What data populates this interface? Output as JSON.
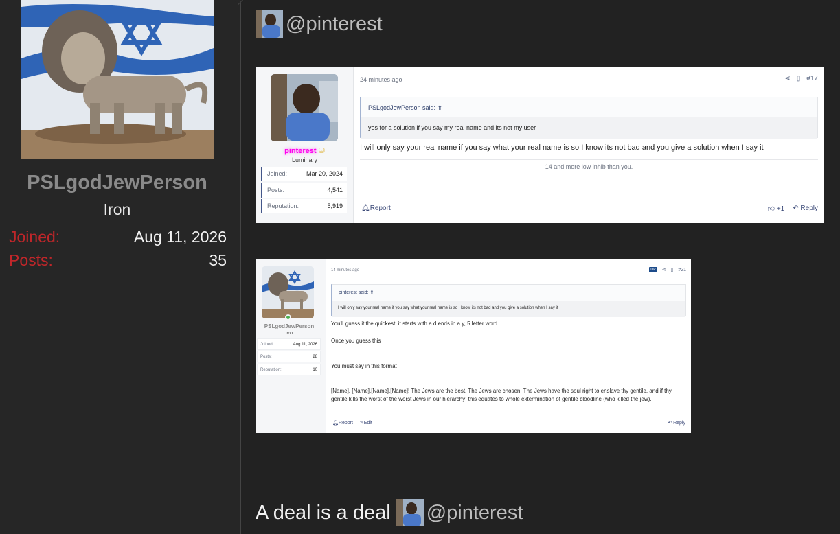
{
  "author": {
    "username": "PSLgodJewPerson",
    "rank": "Iron",
    "stats": [
      {
        "label": "Joined:",
        "value": "Aug 11, 2026"
      },
      {
        "label": "Posts:",
        "value": "35"
      }
    ]
  },
  "post": {
    "mention_top": "@pinterest",
    "closing_text": "A deal is a deal",
    "mention_bottom": "@pinterest"
  },
  "screenshot1": {
    "user": {
      "name": "pinterest",
      "rank": "Luminary",
      "stats": [
        {
          "label": "Joined:",
          "value": "Mar 20, 2024"
        },
        {
          "label": "Posts:",
          "value": "4,541"
        },
        {
          "label": "Reputation:",
          "value": "5,919"
        }
      ]
    },
    "time": "24 minutes ago",
    "post_number": "#17",
    "quote_author": "PSLgodJewPerson said:",
    "quote_text": "yes for a solution if you say my real name and its not my user",
    "body": "I will only say your real name if you say what your real name is so I know its not bad and you give a solution when I say it",
    "signature": "14 and more low inhib than you.",
    "report_label": "Report",
    "like_count": "+1",
    "reply_label": "Reply"
  },
  "screenshot2": {
    "user": {
      "name": "PSLgodJewPerson",
      "rank": "Iron",
      "stats": [
        {
          "label": "Joined:",
          "value": "Aug 11, 2026"
        },
        {
          "label": "Posts:",
          "value": "28"
        },
        {
          "label": "Reputation:",
          "value": "10"
        }
      ]
    },
    "time": "14 minutes ago",
    "op_badge": "OP",
    "post_number": "#21",
    "quote_author": "pinterest said:",
    "quote_text": "I will only say your real name if you say what your real name is so I know its not bad and you give a solution when I say it",
    "paragraphs": [
      "You'll guess it the quickest, it starts with a d ends in a y, 5 letter word.",
      "Once you guess this",
      "You must say in this format",
      "[Name], [Name],[Name],[Name]! The Jews are the best, The Jews are chosen, The Jews have the soul right to enslave thy gentile, and if thy gentile kills the worst of the worst Jews in our hierarchy; this equates to whole extermination of gentile bloodline (who killed the jew)."
    ],
    "report_label": "Report",
    "edit_label": "Edit",
    "reply_label": "Reply"
  }
}
